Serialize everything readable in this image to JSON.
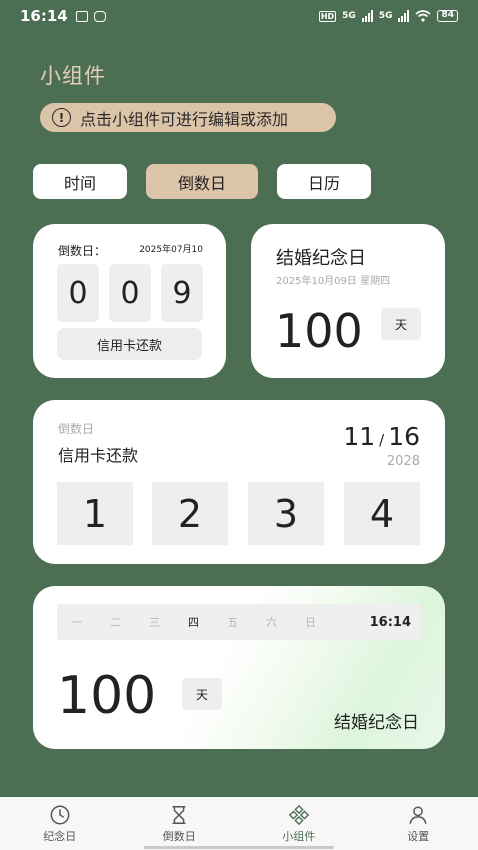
{
  "status_bar": {
    "time": "16:14",
    "network": "5G",
    "battery": "84",
    "hd_label": "HD"
  },
  "page": {
    "title": "小组件",
    "hint": "点击小组件可进行编辑或添加"
  },
  "tabs": [
    {
      "label": "时间",
      "active": false
    },
    {
      "label": "倒数日",
      "active": true
    },
    {
      "label": "日历",
      "active": false
    }
  ],
  "widget_small_countdown": {
    "label": "倒数日：",
    "date": "2025年07月10",
    "digits": [
      "0",
      "0",
      "9"
    ],
    "name": "信用卡还款"
  },
  "widget_small_anniversary": {
    "title": "结婚纪念日",
    "date": "2025年10月09日 星期四",
    "days": "100",
    "unit": "天"
  },
  "widget_medium_countdown": {
    "label": "倒数日",
    "name": "信用卡还款",
    "month": "11",
    "separator": "/",
    "day": "16",
    "year": "2028",
    "digits": [
      "1",
      "2",
      "3",
      "4"
    ]
  },
  "widget_large_anniversary": {
    "weekdays": [
      "一",
      "二",
      "三",
      "四",
      "五",
      "六",
      "日"
    ],
    "current_weekday_index": 3,
    "clock": "16:14",
    "days": "100",
    "unit": "天",
    "name": "结婚纪念日"
  },
  "bottom_nav": [
    {
      "label": "纪念日",
      "icon": "clock-icon",
      "active": false
    },
    {
      "label": "倒数日",
      "icon": "hourglass-icon",
      "active": false
    },
    {
      "label": "小组件",
      "icon": "widget-icon",
      "active": true
    },
    {
      "label": "设置",
      "icon": "person-icon",
      "active": false
    }
  ],
  "colors": {
    "background": "#4c6e52",
    "accent": "#dcc4a8",
    "title": "#e3cfb5"
  }
}
